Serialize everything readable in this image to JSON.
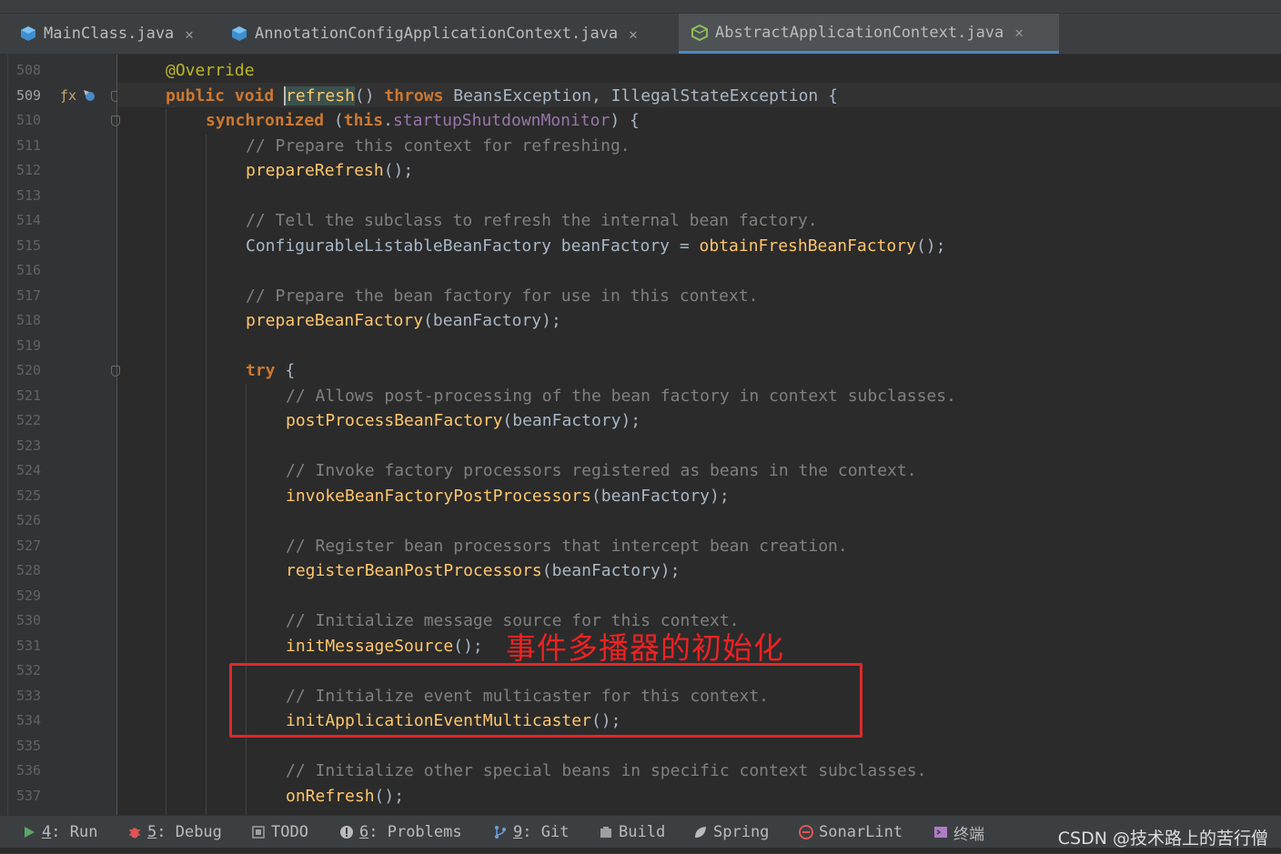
{
  "tabs": [
    {
      "label": "MainClass.java",
      "active": false
    },
    {
      "label": "AnnotationConfigApplicationContext.java",
      "active": false
    },
    {
      "label": "AbstractApplicationContext.java",
      "active": true
    }
  ],
  "annotation_label": "事件多播器的初始化",
  "status": {
    "run": {
      "num": "4",
      "label": ": Run"
    },
    "debug": {
      "num": "5",
      "label": ": Debug"
    },
    "todo": {
      "label": "TODO"
    },
    "problems": {
      "num": "6",
      "label": ": Problems"
    },
    "git": {
      "num": "9",
      "label": ": Git"
    },
    "build": {
      "label": "Build"
    },
    "spring": {
      "label": "Spring"
    },
    "sonarlint": {
      "label": "SonarLint"
    },
    "terminal": {
      "label": "终端"
    },
    "watermark": "CSDN @技术路上的苦行僧"
  },
  "lines": [
    {
      "n": "508",
      "t": "annotation",
      "text": "@Override"
    },
    {
      "n": "509",
      "t": "signature",
      "mods": "public void ",
      "name": "refresh",
      "rest1": "() ",
      "kw2": "throws",
      "rest2": " BeansException, IllegalStateException {"
    },
    {
      "n": "510",
      "t": "sync",
      "kw": "synchronized",
      "open": " (",
      "kw2": "this",
      "dot": ".",
      "field": "startupShutdownMonitor",
      "close": ") {"
    },
    {
      "n": "511",
      "t": "comment",
      "text": "// Prepare this context for refreshing."
    },
    {
      "n": "512",
      "t": "call",
      "fn": "prepareRefresh",
      "args": "();"
    },
    {
      "n": "513",
      "t": "blank"
    },
    {
      "n": "514",
      "t": "comment",
      "text": "// Tell the subclass to refresh the internal bean factory."
    },
    {
      "n": "515",
      "t": "assign",
      "type": "ConfigurableListableBeanFactory",
      "var": " beanFactory = ",
      "fn": "obtainFreshBeanFactory",
      "args": "();"
    },
    {
      "n": "516",
      "t": "blank"
    },
    {
      "n": "517",
      "t": "comment",
      "text": "// Prepare the bean factory for use in this context."
    },
    {
      "n": "518",
      "t": "call",
      "fn": "prepareBeanFactory",
      "args": "(beanFactory);"
    },
    {
      "n": "519",
      "t": "blank"
    },
    {
      "n": "520",
      "t": "try",
      "kw": "try",
      "rest": " {"
    },
    {
      "n": "521",
      "t": "comment",
      "text": "// Allows post-processing of the bean factory in context subclasses."
    },
    {
      "n": "522",
      "t": "call",
      "fn": "postProcessBeanFactory",
      "args": "(beanFactory);"
    },
    {
      "n": "523",
      "t": "blank"
    },
    {
      "n": "524",
      "t": "comment",
      "text": "// Invoke factory processors registered as beans in the context."
    },
    {
      "n": "525",
      "t": "call",
      "fn": "invokeBeanFactoryPostProcessors",
      "args": "(beanFactory);"
    },
    {
      "n": "526",
      "t": "blank"
    },
    {
      "n": "527",
      "t": "comment",
      "text": "// Register bean processors that intercept bean creation."
    },
    {
      "n": "528",
      "t": "call",
      "fn": "registerBeanPostProcessors",
      "args": "(beanFactory);"
    },
    {
      "n": "529",
      "t": "blank"
    },
    {
      "n": "530",
      "t": "comment",
      "text": "// Initialize message source for this context."
    },
    {
      "n": "531",
      "t": "call",
      "fn": "initMessageSource",
      "args": "();"
    },
    {
      "n": "532",
      "t": "blank"
    },
    {
      "n": "533",
      "t": "comment",
      "text": "// Initialize event multicaster for this context."
    },
    {
      "n": "534",
      "t": "call",
      "fn": "initApplicationEventMulticaster",
      "args": "();"
    },
    {
      "n": "535",
      "t": "blank"
    },
    {
      "n": "536",
      "t": "comment",
      "text": "// Initialize other special beans in specific context subclasses."
    },
    {
      "n": "537",
      "t": "call",
      "fn": "onRefresh",
      "args": "();"
    }
  ]
}
